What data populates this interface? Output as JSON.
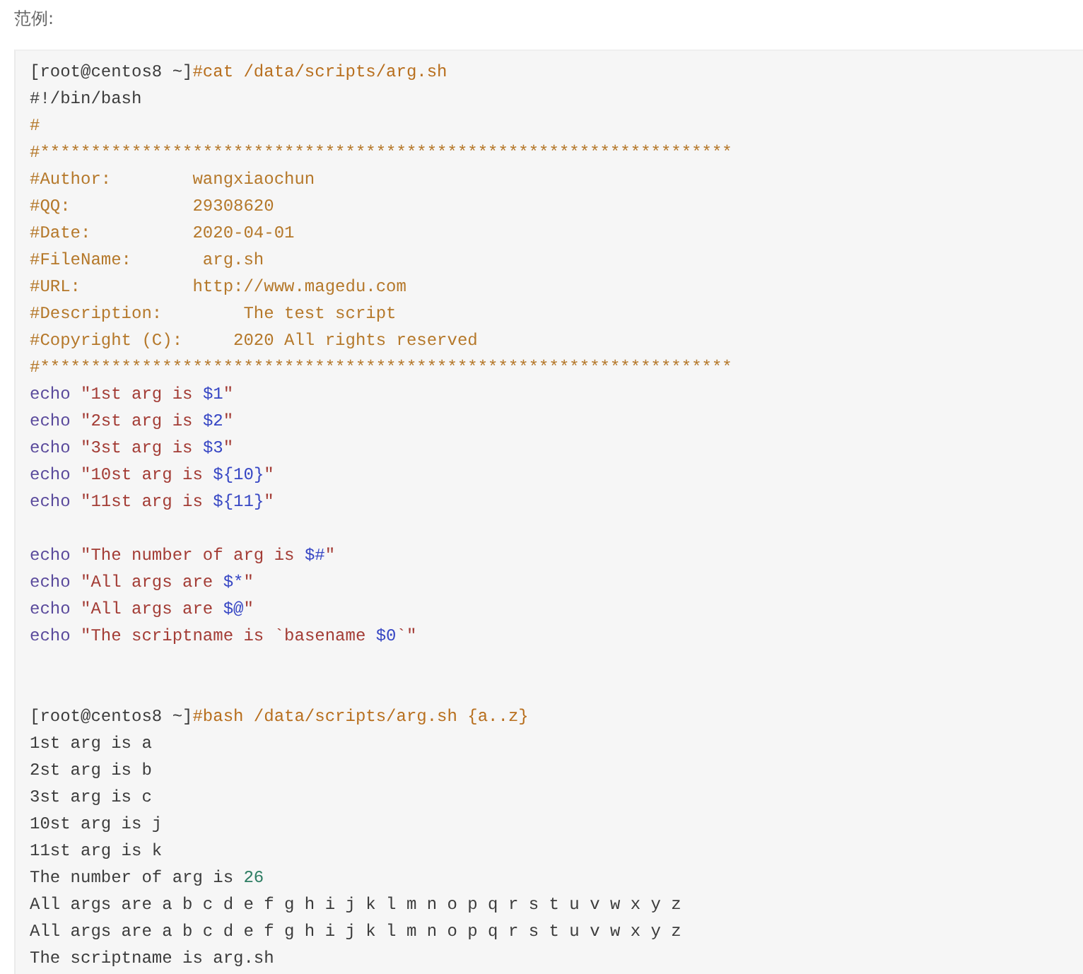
{
  "heading": "范例:",
  "code_lines": [
    {
      "kind": "code",
      "tokens": [
        {
          "kind": "plain",
          "text": "[root@centos8 ~]"
        },
        {
          "kind": "command",
          "text": "#cat /data/scripts/arg.sh"
        }
      ]
    },
    {
      "kind": "code",
      "tokens": [
        {
          "kind": "plain",
          "text": "#!/bin/bash"
        }
      ]
    },
    {
      "kind": "code",
      "tokens": [
        {
          "kind": "comment",
          "text": "#"
        }
      ]
    },
    {
      "kind": "code",
      "tokens": [
        {
          "kind": "comment",
          "text": "#********************************************************************"
        }
      ]
    },
    {
      "kind": "code",
      "tokens": [
        {
          "kind": "comment",
          "text": "#Author:        wangxiaochun"
        }
      ]
    },
    {
      "kind": "code",
      "tokens": [
        {
          "kind": "comment",
          "text": "#QQ:            29308620"
        }
      ]
    },
    {
      "kind": "code",
      "tokens": [
        {
          "kind": "comment",
          "text": "#Date:          2020-04-01"
        }
      ]
    },
    {
      "kind": "code",
      "tokens": [
        {
          "kind": "comment",
          "text": "#FileName:       arg.sh"
        }
      ]
    },
    {
      "kind": "code",
      "tokens": [
        {
          "kind": "comment",
          "text": "#URL:           http://www.magedu.com"
        }
      ]
    },
    {
      "kind": "code",
      "tokens": [
        {
          "kind": "comment",
          "text": "#Description:        The test script"
        }
      ]
    },
    {
      "kind": "code",
      "tokens": [
        {
          "kind": "comment",
          "text": "#Copyright (C):     2020 All rights reserved"
        }
      ]
    },
    {
      "kind": "code",
      "tokens": [
        {
          "kind": "comment",
          "text": "#********************************************************************"
        }
      ]
    },
    {
      "kind": "code",
      "tokens": [
        {
          "kind": "keyword",
          "text": "echo "
        },
        {
          "kind": "string",
          "text": "\"1st arg is "
        },
        {
          "kind": "variable",
          "text": "$1"
        },
        {
          "kind": "string",
          "text": "\""
        }
      ]
    },
    {
      "kind": "code",
      "tokens": [
        {
          "kind": "keyword",
          "text": "echo "
        },
        {
          "kind": "string",
          "text": "\"2st arg is "
        },
        {
          "kind": "variable",
          "text": "$2"
        },
        {
          "kind": "string",
          "text": "\""
        }
      ]
    },
    {
      "kind": "code",
      "tokens": [
        {
          "kind": "keyword",
          "text": "echo "
        },
        {
          "kind": "string",
          "text": "\"3st arg is "
        },
        {
          "kind": "variable",
          "text": "$3"
        },
        {
          "kind": "string",
          "text": "\""
        }
      ]
    },
    {
      "kind": "code",
      "tokens": [
        {
          "kind": "keyword",
          "text": "echo "
        },
        {
          "kind": "string",
          "text": "\"10st arg is "
        },
        {
          "kind": "variable",
          "text": "${10}"
        },
        {
          "kind": "string",
          "text": "\""
        }
      ]
    },
    {
      "kind": "code",
      "tokens": [
        {
          "kind": "keyword",
          "text": "echo "
        },
        {
          "kind": "string",
          "text": "\"11st arg is "
        },
        {
          "kind": "variable",
          "text": "${11}"
        },
        {
          "kind": "string",
          "text": "\""
        }
      ]
    },
    {
      "kind": "blank"
    },
    {
      "kind": "code",
      "tokens": [
        {
          "kind": "keyword",
          "text": "echo "
        },
        {
          "kind": "string",
          "text": "\"The number of arg is "
        },
        {
          "kind": "variable",
          "text": "$#"
        },
        {
          "kind": "string",
          "text": "\""
        }
      ]
    },
    {
      "kind": "code",
      "tokens": [
        {
          "kind": "keyword",
          "text": "echo "
        },
        {
          "kind": "string",
          "text": "\"All args are "
        },
        {
          "kind": "variable",
          "text": "$*"
        },
        {
          "kind": "string",
          "text": "\""
        }
      ]
    },
    {
      "kind": "code",
      "tokens": [
        {
          "kind": "keyword",
          "text": "echo "
        },
        {
          "kind": "string",
          "text": "\"All args are "
        },
        {
          "kind": "variable",
          "text": "$@"
        },
        {
          "kind": "string",
          "text": "\""
        }
      ]
    },
    {
      "kind": "code",
      "tokens": [
        {
          "kind": "keyword",
          "text": "echo "
        },
        {
          "kind": "string",
          "text": "\"The scriptname is `basename "
        },
        {
          "kind": "variable",
          "text": "$0"
        },
        {
          "kind": "string",
          "text": "`\""
        }
      ]
    },
    {
      "kind": "blank"
    },
    {
      "kind": "blank"
    },
    {
      "kind": "code",
      "tokens": [
        {
          "kind": "plain",
          "text": "[root@centos8 ~]"
        },
        {
          "kind": "command",
          "text": "#bash /data/scripts/arg.sh {a..z}"
        }
      ]
    },
    {
      "kind": "code",
      "tokens": [
        {
          "kind": "plain",
          "text": "1st arg is a"
        }
      ]
    },
    {
      "kind": "code",
      "tokens": [
        {
          "kind": "plain",
          "text": "2st arg is b"
        }
      ]
    },
    {
      "kind": "code",
      "tokens": [
        {
          "kind": "plain",
          "text": "3st arg is c"
        }
      ]
    },
    {
      "kind": "code",
      "tokens": [
        {
          "kind": "plain",
          "text": "10st arg is j"
        }
      ]
    },
    {
      "kind": "code",
      "tokens": [
        {
          "kind": "plain",
          "text": "11st arg is k"
        }
      ]
    },
    {
      "kind": "code",
      "tokens": [
        {
          "kind": "plain",
          "text": "The number of arg is "
        },
        {
          "kind": "number",
          "text": "26"
        }
      ]
    },
    {
      "kind": "code",
      "tokens": [
        {
          "kind": "plain",
          "text": "All args are a b c d e f g h i j k l m n o p q r s t u v w x y z"
        }
      ]
    },
    {
      "kind": "code",
      "tokens": [
        {
          "kind": "plain",
          "text": "All args are a b c d e f g h i j k l m n o p q r s t u v w x y z"
        }
      ]
    },
    {
      "kind": "code",
      "tokens": [
        {
          "kind": "plain",
          "text": "The scriptname is arg.sh"
        }
      ]
    }
  ]
}
